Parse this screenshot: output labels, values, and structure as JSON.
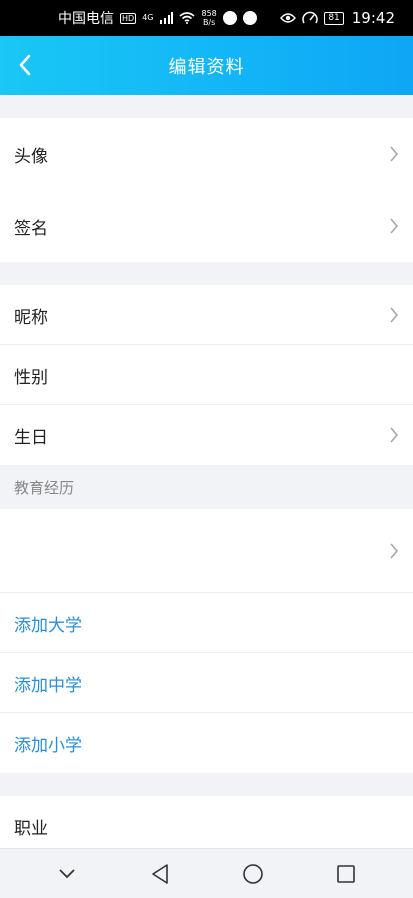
{
  "status_bar": {
    "carrier": "中国电信",
    "hd": "HD",
    "network": "4G",
    "speed_value": "858",
    "speed_unit": "B/s",
    "battery": "81",
    "time": "19:42"
  },
  "nav": {
    "title": "编辑资料"
  },
  "profile": {
    "avatar_label": "头像",
    "signature_label": "签名",
    "nickname_label": "昵称",
    "gender_label": "性别",
    "birthday_label": "生日"
  },
  "education": {
    "header": "教育经历",
    "add_university": "添加大学",
    "add_middle_school": "添加中学",
    "add_primary_school": "添加小学"
  },
  "career": {
    "job_label": "职业"
  },
  "colors": {
    "accent": "#12b4f7",
    "link": "#2a8fd6",
    "background": "#f2f3f7"
  }
}
